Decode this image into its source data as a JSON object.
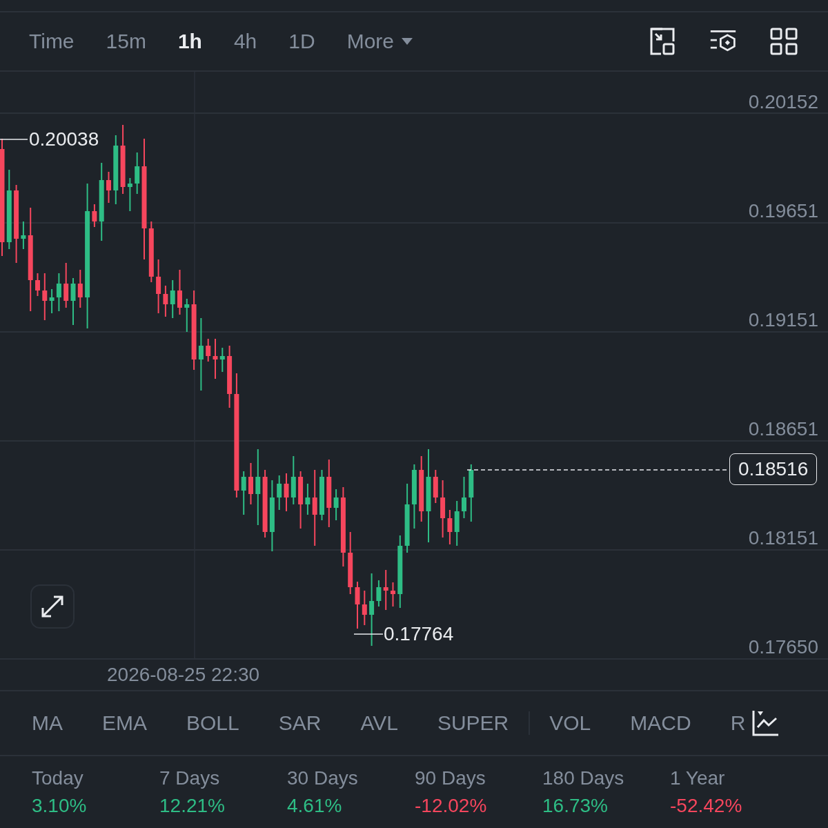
{
  "timeframes": [
    {
      "label": "Time",
      "selected": false
    },
    {
      "label": "15m",
      "selected": false
    },
    {
      "label": "1h",
      "selected": true
    },
    {
      "label": "4h",
      "selected": false
    },
    {
      "label": "1D",
      "selected": false
    }
  ],
  "more": {
    "label": "More"
  },
  "chart": {
    "y_labels": [
      "0.20152",
      "0.19651",
      "0.19151",
      "0.18651",
      "0.18151",
      "0.17650"
    ],
    "high_marker": "0.20038",
    "low_marker": "0.17764",
    "last_price": "0.18516",
    "time_label": "2026-08-25 22:30"
  },
  "main_indicators": [
    "MA",
    "EMA",
    "BOLL",
    "SAR",
    "AVL",
    "SUPER"
  ],
  "sub_indicators": [
    "VOL",
    "MACD",
    "R"
  ],
  "stats": [
    {
      "label": "Today",
      "value": "3.10%",
      "color": "#2ebd85"
    },
    {
      "label": "7 Days",
      "value": "12.21%",
      "color": "#2ebd85"
    },
    {
      "label": "30 Days",
      "value": "4.61%",
      "color": "#2ebd85"
    },
    {
      "label": "90 Days",
      "value": "-12.02%",
      "color": "#f6465d"
    },
    {
      "label": "180 Days",
      "value": "16.73%",
      "color": "#2ebd85"
    },
    {
      "label": "1 Year",
      "value": "-52.42%",
      "color": "#f6465d"
    }
  ]
}
